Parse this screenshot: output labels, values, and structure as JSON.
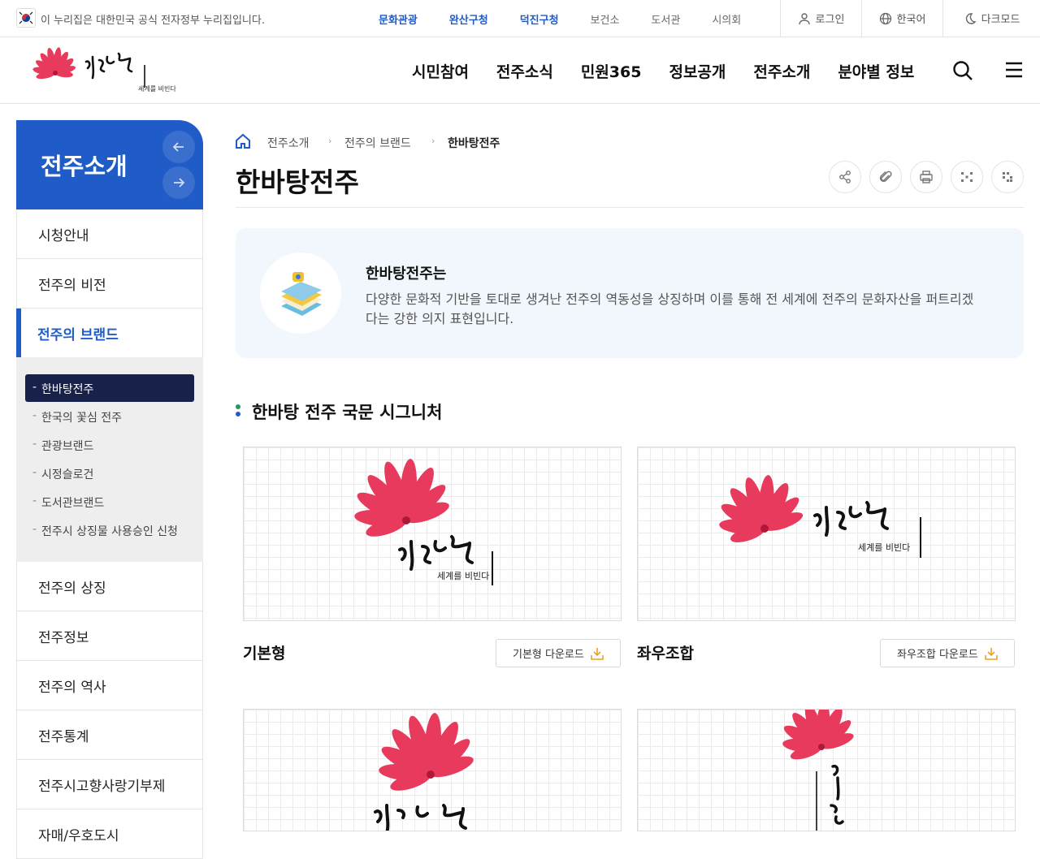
{
  "topbar": {
    "notice": "이 누리집은 대한민국 공식 전자정부 누리집입니다.",
    "sites": [
      "문화관광",
      "완산구청",
      "덕진구청",
      "보건소",
      "도서관",
      "시의회"
    ],
    "login": "로그인",
    "language": "한국어",
    "dark_mode": "다크모드"
  },
  "header": {
    "logo_text": "한바탕 전주",
    "logo_sub": "세계를 비빈다",
    "nav": [
      "시민참여",
      "전주소식",
      "민원365",
      "정보공개",
      "전주소개",
      "분야별 정보"
    ]
  },
  "sidebar": {
    "title": "전주소개",
    "menu_top": [
      "시청안내",
      "전주의 비전",
      "전주의 브랜드"
    ],
    "submenu": [
      "한바탕전주",
      "한국의 꽃심 전주",
      "관광브랜드",
      "시정슬로건",
      "도서관브랜드",
      "전주시 상징물 사용승인 신청"
    ],
    "menu_bottom": [
      "전주의 상징",
      "전주정보",
      "전주의 역사",
      "전주통계",
      "전주시고향사랑기부제",
      "자매/우호도시"
    ]
  },
  "breadcrumb": [
    "전주소개",
    "전주의 브랜드",
    "한바탕전주"
  ],
  "page": {
    "title": "한바탕전주",
    "intro_heading": "한바탕전주는",
    "intro_text": "다양한 문화적 기반을 토대로 생겨난 전주의 역동성을 상징하며 이를 통해 전 세계에 전주의 문화자산을 퍼트리겠다는 강한 의지 표현입니다.",
    "section_title": "한바탕 전주 국문 시그니처",
    "cards": [
      {
        "name": "기본형",
        "download": "기본형 다운로드"
      },
      {
        "name": "좌우조합",
        "download": "좌우조합 다운로드"
      }
    ]
  },
  "colors": {
    "accent": "#1f5cc8",
    "active_sub": "#18214a",
    "flower": "#e83a5c",
    "section_dot_top": "#1c9a6b",
    "section_dot_bottom": "#1f5cc8"
  }
}
